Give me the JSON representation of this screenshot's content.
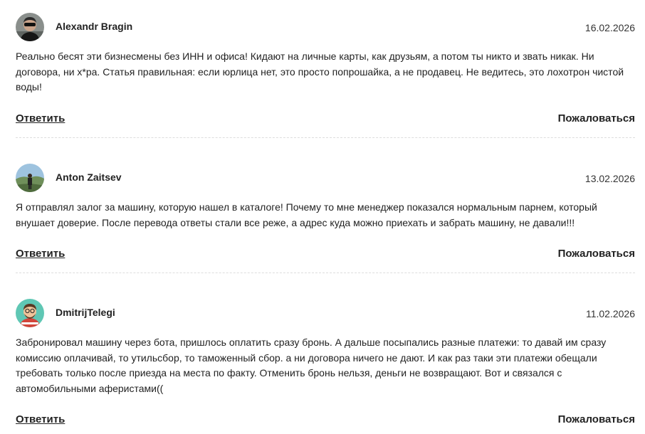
{
  "comments": [
    {
      "author": "Alexandr Bragin",
      "date": "16.02.2026",
      "text": "Реально бесят эти бизнесмены без ИНН и офиса! Кидают на личные карты, как друзьям, а потом ты никто и звать никак. Ни договора, ни х*ра. Статья правильная: если юрлица нет, это просто попрошайка, а не продавец. Не ведитесь, это лохотрон чистой воды!",
      "reply_label": "Ответить",
      "report_label": "Пожаловаться"
    },
    {
      "author": "Anton Zaitsev",
      "date": "13.02.2026",
      "text": "Я отправлял залог за машину, которую нашел в каталоге! Почему то мне менеджер показался нормальным парнем, который внушает доверие. После перевода ответы стали все реже, а адрес куда можно приехать и забрать машину, не давали!!!",
      "reply_label": "Ответить",
      "report_label": "Пожаловаться"
    },
    {
      "author": "DmitrijTelegi",
      "date": "11.02.2026",
      "text": "Забронировал машину через бота, пришлось оплатить сразу бронь. А дальше посыпались разные платежи: то давай им сразу комиссию оплачивай, то утильсбор, то таможенный сбор. а ни договора ничего не дают. И как раз таки эти платежи обещали требовать только после приезда на места по факту. Отменить бронь нельзя, деньги не возвращают. Вот и связался с автомобильными аферистами((",
      "reply_label": "Ответить",
      "report_label": "Пожаловаться"
    }
  ]
}
